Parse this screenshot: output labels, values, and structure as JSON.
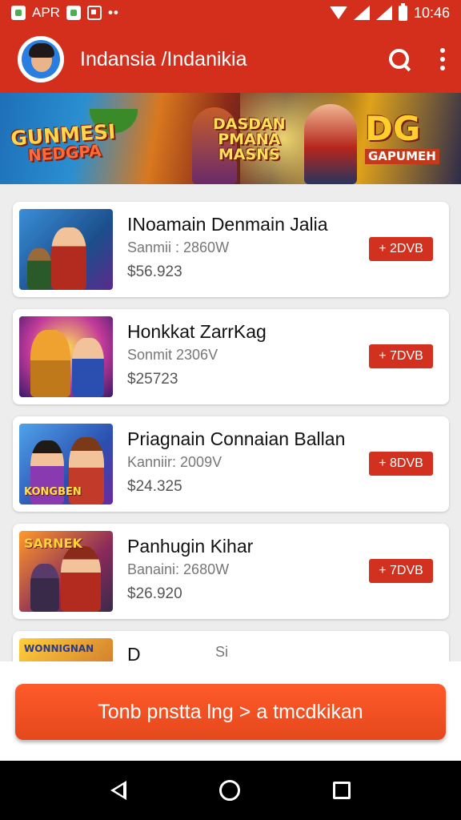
{
  "status_bar": {
    "left_text": "APR",
    "dots": "••",
    "time": "10:46",
    "icons": [
      "photo-icon",
      "news-icon",
      "wifi-icon",
      "signal-icon",
      "battery-icon"
    ]
  },
  "app_bar": {
    "title": "Indansia /Indanikia",
    "icons": [
      "avatar",
      "search-icon",
      "more-icon"
    ],
    "color": "#d32f1c"
  },
  "banner": {
    "text_left_1": "GUNMESI",
    "text_left_2": "NEDGPA",
    "text_mid_1": "DASDAN",
    "text_mid_2": "PMANA",
    "text_mid_3": "MASNS",
    "text_right_1": "DG",
    "text_right_2": "GAPUMEH"
  },
  "items": [
    {
      "title": "INoamain Denmain Jalia",
      "meta": "Sanmii :  2860W",
      "price": "$56.923",
      "button": "+ 2DVB"
    },
    {
      "title": "Honkkat ZarrKag",
      "meta": "Sonmit  2306V",
      "price": "$25723",
      "button": "+ 7DVB"
    },
    {
      "title": "Priagnain Connaian Ballan",
      "meta": "Kanniir:  2009V",
      "price": "$24.325",
      "button": "+ 8DVB",
      "thumb_label": "KONGBEN"
    },
    {
      "title": "Panhugin Kihar",
      "meta": "Banaini:  2680W",
      "price": "$26.920",
      "button": "+ 7DVB",
      "thumb_label": "SARNEK"
    }
  ],
  "partial_item": {
    "title": "D",
    "meta": "Si",
    "thumb_label": "WONNIGNAN"
  },
  "cta": {
    "label": "Tonb pnstta lng  >  a tmcdkikan"
  },
  "nav": {
    "icons": [
      "back-icon",
      "home-icon",
      "recents-icon"
    ]
  },
  "colors": {
    "accent": "#d3311f",
    "cta": "#ff5a2a"
  }
}
